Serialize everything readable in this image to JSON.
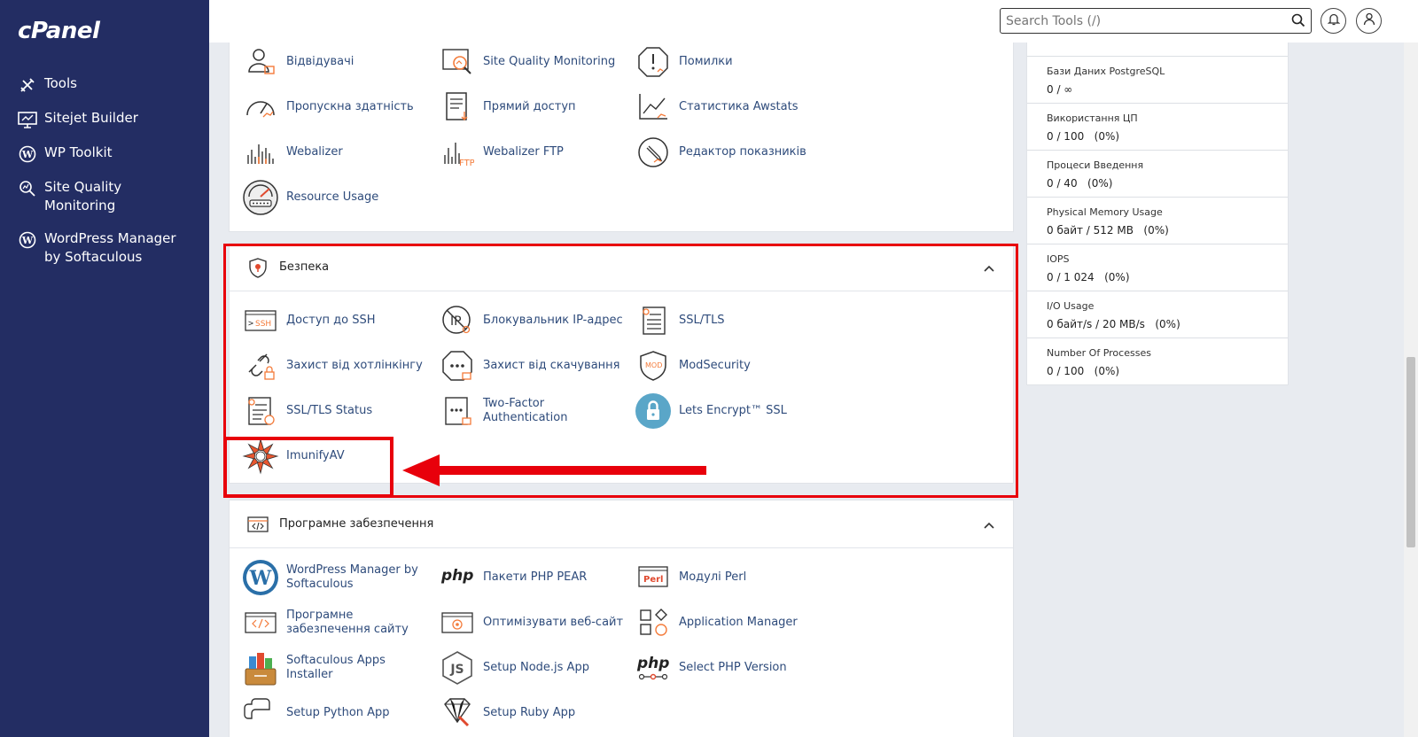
{
  "app": {
    "logo": "cPanel"
  },
  "sidebar": {
    "items": [
      {
        "label": "Tools",
        "icon": "tools-icon"
      },
      {
        "label": "Sitejet Builder",
        "icon": "monitor-icon"
      },
      {
        "label": "WP Toolkit",
        "icon": "wordpress-icon"
      },
      {
        "label": "Site Quality Monitoring",
        "icon": "magnifier-chart-icon"
      },
      {
        "label": "WordPress Manager by Softaculous",
        "icon": "wordpress-icon"
      }
    ]
  },
  "header": {
    "search_placeholder": "Search Tools (/)"
  },
  "metrics_panel": {
    "tools": [
      {
        "label": "Відвідувачі",
        "icon": "visitors-icon"
      },
      {
        "label": "Site Quality Monitoring",
        "icon": "site-quality-icon"
      },
      {
        "label": "Помилки",
        "icon": "errors-icon"
      },
      {
        "label": "Пропускна здатність",
        "icon": "bandwidth-icon"
      },
      {
        "label": "Прямий доступ",
        "icon": "raw-access-icon"
      },
      {
        "label": "Статистика Awstats",
        "icon": "awstats-icon"
      },
      {
        "label": "Webalizer",
        "icon": "webalizer-icon"
      },
      {
        "label": "Webalizer FTP",
        "icon": "webalizer-ftp-icon"
      },
      {
        "label": "Редактор показників",
        "icon": "metrics-editor-icon"
      },
      {
        "label": "Resource Usage",
        "icon": "resource-usage-icon"
      }
    ]
  },
  "security_panel": {
    "title": "Безпека",
    "tools": [
      {
        "label": "Доступ до SSH",
        "icon": "ssh-icon"
      },
      {
        "label": "Блокувальник IP-адрес",
        "icon": "ip-blocker-icon"
      },
      {
        "label": "SSL/TLS",
        "icon": "ssl-certificate-icon"
      },
      {
        "label": "Захист від хотлінкінгу",
        "icon": "hotlink-protection-icon"
      },
      {
        "label": "Захист від скачування",
        "icon": "leech-protection-icon"
      },
      {
        "label": "ModSecurity",
        "icon": "modsecurity-icon"
      },
      {
        "label": "SSL/TLS Status",
        "icon": "ssl-status-icon"
      },
      {
        "label": "Two-Factor Authentication",
        "icon": "two-factor-icon"
      },
      {
        "label": "Lets Encrypt™ SSL",
        "icon": "lets-encrypt-icon"
      },
      {
        "label": "ImunifyAV",
        "icon": "imunifyav-icon"
      }
    ]
  },
  "software_panel": {
    "title": "Програмне забезпечення",
    "tools": [
      {
        "label": "WordPress Manager by Softaculous",
        "icon": "wordpress-icon"
      },
      {
        "label": "Пакети PHP PEAR",
        "icon": "php-icon",
        "icon_text": "php"
      },
      {
        "label": "Модулі Perl",
        "icon": "perl-icon",
        "icon_text": "Perl"
      },
      {
        "label": "Програмне забезпечення сайту",
        "icon": "site-software-icon"
      },
      {
        "label": "Оптимізувати веб-сайт",
        "icon": "optimize-icon"
      },
      {
        "label": "Application Manager",
        "icon": "app-manager-icon"
      },
      {
        "label": "Softaculous Apps Installer",
        "icon": "softaculous-icon"
      },
      {
        "label": "Setup Node.js App",
        "icon": "nodejs-icon"
      },
      {
        "label": "Select PHP Version",
        "icon": "php-version-icon",
        "icon_text": "php"
      },
      {
        "label": "Setup Python App",
        "icon": "python-icon"
      },
      {
        "label": "Setup Ruby App",
        "icon": "ruby-icon"
      }
    ]
  },
  "stats": [
    {
      "name": "Бази Даних PostgreSQL",
      "value": "0 / ∞"
    },
    {
      "name": "Використання ЦП",
      "value": "0 / 100   (0%)"
    },
    {
      "name": "Процеси Введення",
      "value": "0 / 40   (0%)"
    },
    {
      "name": "Physical Memory Usage",
      "value": "0 байт / 512 MB   (0%)"
    },
    {
      "name": "IOPS",
      "value": "0 / 1 024   (0%)"
    },
    {
      "name": "I/O Usage",
      "value": "0 байт/s / 20 MB/s   (0%)"
    },
    {
      "name": "Number Of Processes",
      "value": "0 / 100   (0%)"
    }
  ],
  "colors": {
    "sidebar": "#232d63",
    "link": "#2e4b7b",
    "annotation": "#e8000b",
    "accent_orange": "#f47b3a"
  }
}
